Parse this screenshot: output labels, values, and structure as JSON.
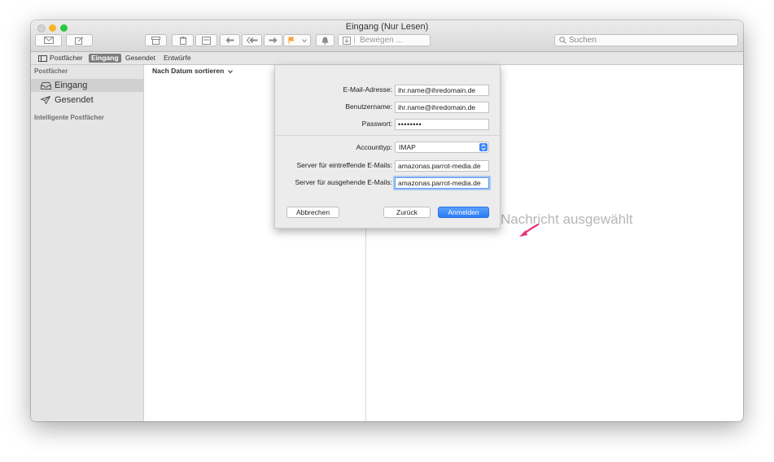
{
  "window": {
    "title": "Eingang (Nur Lesen)"
  },
  "toolbar": {
    "move_placeholder": "Bewegen ...",
    "search_placeholder": "Suchen"
  },
  "favorites": {
    "mailboxes": "Postfächer",
    "inbox": "Eingang",
    "sent": "Gesendet",
    "drafts": "Entwürfe"
  },
  "sidebar": {
    "section_mailboxes": "Postfächer",
    "items": [
      {
        "label": "Eingang",
        "icon": "inbox-icon",
        "selected": true
      },
      {
        "label": "Gesendet",
        "icon": "paper-plane-icon",
        "selected": false
      }
    ],
    "section_smart": "Intelligente Postfächer"
  },
  "list": {
    "sort_label": "Nach Datum sortieren"
  },
  "preview": {
    "placeholder": "Nachricht ausgewählt"
  },
  "dialog": {
    "email_label": "E-Mail-Adresse:",
    "email_value": "ihr.name@ihredomain.de",
    "username_label": "Benutzername:",
    "username_value": "ihr.name@ihredomain.de",
    "password_label": "Passwort:",
    "password_value": "••••••••",
    "account_type_label": "Accounttyp:",
    "account_type_value": "IMAP",
    "incoming_label": "Server für eintreffende E-Mails:",
    "incoming_value": "amazonas.parrot-media.de",
    "outgoing_label": "Server für ausgehende E-Mails:",
    "outgoing_value": "amazonas.parrot-media.de",
    "cancel_label": "Abbrechen",
    "back_label": "Zurück",
    "signin_label": "Anmelden"
  },
  "colors": {
    "accent": "#2a7cf3",
    "pointer": "#e8327a",
    "flag": "#f7a541"
  }
}
